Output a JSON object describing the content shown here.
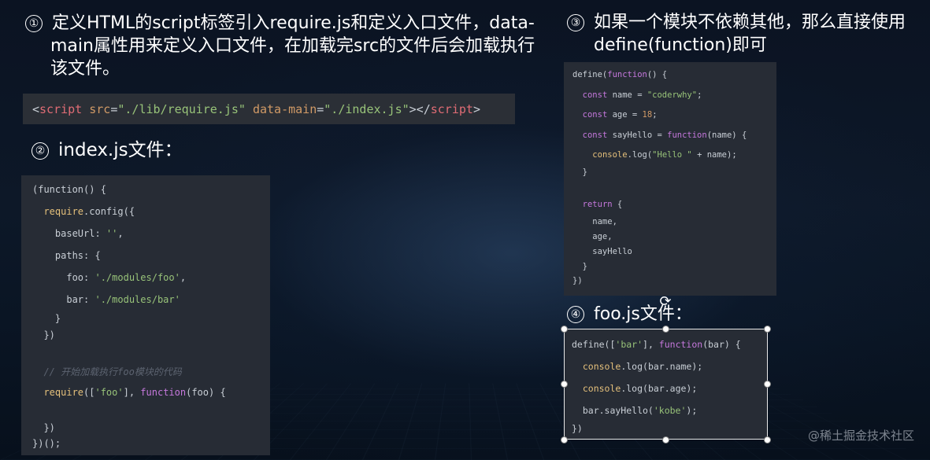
{
  "step1": {
    "number": "①",
    "text_line1": "定义HTML的script标签引入require.js和定义入口文件，data-",
    "text_line2": "main属性用来定义入口文件，在加载完src的文件后会加载执行",
    "text_line3": "该文件。"
  },
  "script_tag": {
    "open": "<",
    "tag": "script",
    "attr1": " src",
    "eq1": "=",
    "val1": "\"./lib/require.js\"",
    "attr2": " data-main",
    "eq2": "=",
    "val2": "\"./index.js\"",
    "close_open": "></",
    "tag_close": "script",
    "close": ">"
  },
  "step2": {
    "number": "②",
    "title": "index.js文件："
  },
  "index_code": [
    "(function() {",
    "  require.config({",
    "    baseUrl: '',",
    "    paths: {",
    "      foo: './modules/foo',",
    "      bar: './modules/bar'",
    "    }",
    "  })",
    "  // 开始加载执行foo模块的代码",
    "  require(['foo'], function(foo) {",
    "  })",
    "})();"
  ],
  "step3": {
    "number": "③",
    "text_line1": "如果一个模块不依赖其他，那么直接使用",
    "text_line2": "define(function)即可"
  },
  "bar_code": [
    "define(function() {",
    "  const name = \"coderwhy\";",
    "  const age = 18;",
    "  const sayHello = function(name) {",
    "    console.log(\"Hello \" + name);",
    "  }",
    "  return {",
    "    name,",
    "    age,",
    "    sayHello",
    "  }",
    "})"
  ],
  "step4": {
    "number": "④",
    "title": "foo.js文件："
  },
  "foo_code": [
    "define(['bar'], function(bar) {",
    "  console.log(bar.name);",
    "  console.log(bar.age);",
    "  bar.sayHello('kobe');",
    "})"
  ],
  "watermark": "@稀土掘金技术社区",
  "rotate_icon": "rotate-handle-icon"
}
